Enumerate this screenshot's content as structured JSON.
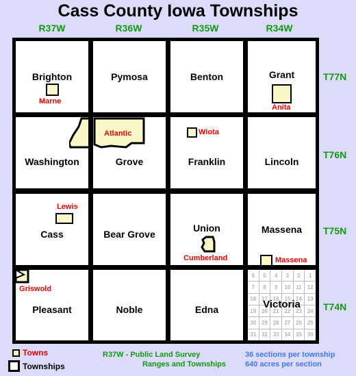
{
  "title": "Cass County Iowa Townships",
  "colors": {
    "background": "#dcdcfa",
    "township_fill": "#ffffff",
    "township_border": "#000000",
    "town_fill": "#faf8c8",
    "town_label": "#ee0000",
    "range_label": "#119911",
    "section_text": "#b4b4b4",
    "note_blue": "#4477ee"
  },
  "ranges": [
    {
      "label": "R37W"
    },
    {
      "label": "R36W"
    },
    {
      "label": "R35W"
    },
    {
      "label": "R34W"
    }
  ],
  "townships_rows": [
    {
      "label": "T77N"
    },
    {
      "label": "T76N"
    },
    {
      "label": "T75N"
    },
    {
      "label": "T74N"
    }
  ],
  "townships": [
    {
      "name": "Brighton",
      "row": 0,
      "col": 0
    },
    {
      "name": "Pymosa",
      "row": 0,
      "col": 1
    },
    {
      "name": "Benton",
      "row": 0,
      "col": 2
    },
    {
      "name": "Grant",
      "row": 0,
      "col": 3
    },
    {
      "name": "Washington",
      "row": 1,
      "col": 0
    },
    {
      "name": "Grove",
      "row": 1,
      "col": 1
    },
    {
      "name": "Franklin",
      "row": 1,
      "col": 2
    },
    {
      "name": "Lincoln",
      "row": 1,
      "col": 3
    },
    {
      "name": "Cass",
      "row": 2,
      "col": 0
    },
    {
      "name": "Bear Grove",
      "row": 2,
      "col": 1
    },
    {
      "name": "Union",
      "row": 2,
      "col": 2
    },
    {
      "name": "Massena",
      "row": 2,
      "col": 3
    },
    {
      "name": "Pleasant",
      "row": 3,
      "col": 0
    },
    {
      "name": "Noble",
      "row": 3,
      "col": 1
    },
    {
      "name": "Edna",
      "row": 3,
      "col": 2
    },
    {
      "name": "Victoria",
      "row": 3,
      "col": 3
    }
  ],
  "towns": [
    {
      "name": "Marne",
      "township": "Brighton"
    },
    {
      "name": "Anita",
      "township": "Grant"
    },
    {
      "name": "Atlantic",
      "township": "Grove"
    },
    {
      "name": "Wiota",
      "township": "Franklin"
    },
    {
      "name": "Lewis",
      "township": "Cass"
    },
    {
      "name": "Cumberland",
      "township": "Union"
    },
    {
      "name": "Massena",
      "township": "Massena"
    },
    {
      "name": "Griswold",
      "township": "Pleasant"
    }
  ],
  "section_grid": {
    "township": "Victoria",
    "numbers": [
      [
        "6",
        "5",
        "4",
        "3",
        "2",
        "1"
      ],
      [
        "7",
        "8",
        "9",
        "10",
        "11",
        "12"
      ],
      [
        "18",
        "17",
        "16",
        "15",
        "14",
        "13"
      ],
      [
        "19",
        "20",
        "21",
        "22",
        "23",
        "24"
      ],
      [
        "30",
        "29",
        "28",
        "27",
        "26",
        "25"
      ],
      [
        "31",
        "32",
        "33",
        "34",
        "35",
        "36"
      ]
    ]
  },
  "legend": {
    "towns_label": "Towns",
    "townships_label": "Townships"
  },
  "notes": {
    "pls_line1": "R37W - Public Land Survey",
    "pls_line2": "Ranges and Townships",
    "sections_line1": "36 sections per township",
    "sections_line2": "640 acres per section"
  }
}
